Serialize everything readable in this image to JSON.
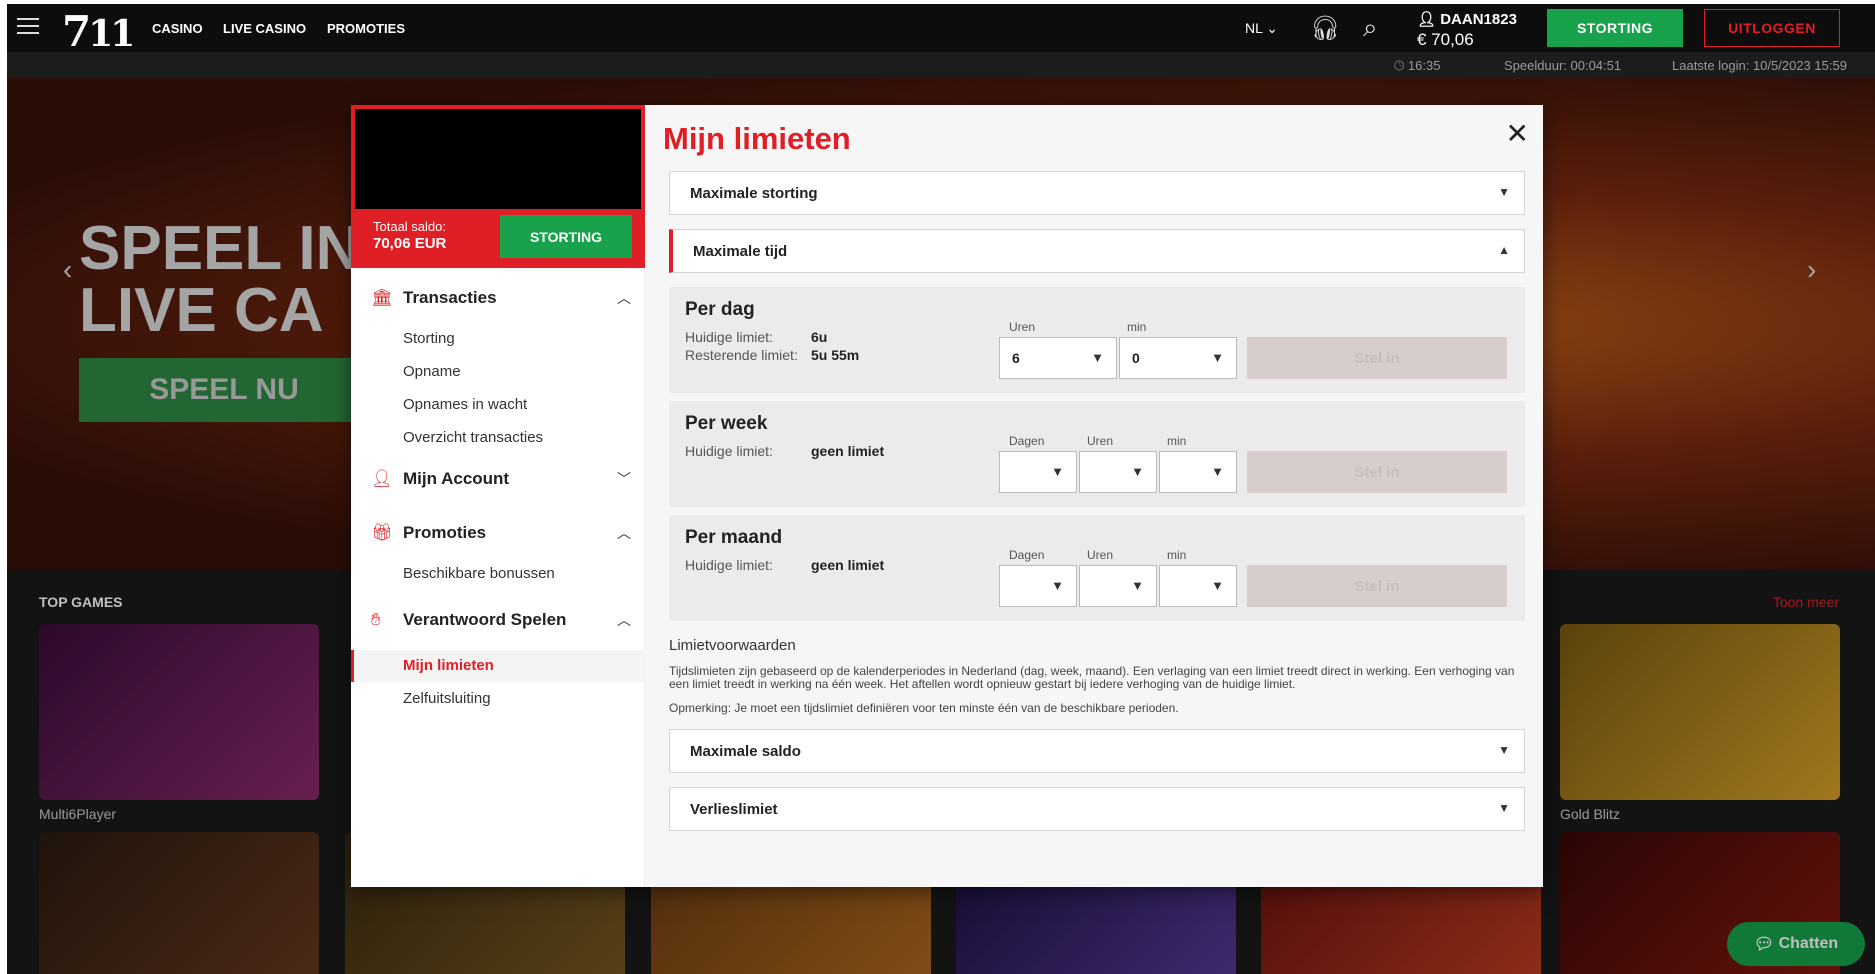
{
  "header": {
    "logo_main": "7",
    "logo_sub": "11",
    "nav": [
      "CASINO",
      "LIVE CASINO",
      "PROMOTIES"
    ],
    "language": "NL",
    "username": "DAAN1823",
    "balance": "€ 70,06",
    "deposit_label": "STORTING",
    "logout_label": "UITLOGGEN"
  },
  "subbar": {
    "time": "16:35",
    "playtime": "Speelduur: 00:04:51",
    "last_login": "Laatste login: 10/5/2023 15:59"
  },
  "hero": {
    "title_line1": "SPEEL IN",
    "title_line2": "LIVE CA",
    "cta": "SPEEL NU"
  },
  "games": {
    "title": "TOP GAMES",
    "more": "Toon meer",
    "tiles": [
      "Multi6Player",
      "Gold Blitz"
    ],
    "chat_label": "Chatten"
  },
  "sidebar": {
    "saldo_label": "Totaal saldo:",
    "saldo_value": "70,06 EUR",
    "deposit_label": "STORTING",
    "sections": [
      {
        "label": "Transacties",
        "icon": "bank-icon",
        "items": [
          "Storting",
          "Opname",
          "Opnames in wacht",
          "Overzicht transacties"
        ]
      },
      {
        "label": "Mijn Account",
        "icon": "user-icon",
        "items": []
      },
      {
        "label": "Promoties",
        "icon": "gift-icon",
        "items": [
          "Beschikbare bonussen"
        ]
      },
      {
        "label": "Verantwoord Spelen",
        "icon": "hand-icon",
        "items": [
          "Mijn limieten",
          "Zelfuitsluiting"
        ]
      }
    ]
  },
  "limits": {
    "title": "Mijn limieten",
    "accordions": {
      "max_deposit": "Maximale storting",
      "max_time": "Maximale tijd",
      "max_balance": "Maximale saldo",
      "loss_limit": "Verlieslimiet"
    },
    "periods": [
      {
        "title": "Per dag",
        "current_label": "Huidige limiet:",
        "current_value": "6u",
        "remaining_label": "Resterende limiet:",
        "remaining_value": "5u 55m",
        "fields": [
          {
            "label": "Uren",
            "value": "6"
          },
          {
            "label": "min",
            "value": "0"
          }
        ],
        "button": "Stel in"
      },
      {
        "title": "Per week",
        "current_label": "Huidige limiet:",
        "current_value": "geen limiet",
        "fields": [
          {
            "label": "Dagen",
            "value": ""
          },
          {
            "label": "Uren",
            "value": ""
          },
          {
            "label": "min",
            "value": ""
          }
        ],
        "button": "Stel in"
      },
      {
        "title": "Per maand",
        "current_label": "Huidige limiet:",
        "current_value": "geen limiet",
        "fields": [
          {
            "label": "Dagen",
            "value": ""
          },
          {
            "label": "Uren",
            "value": ""
          },
          {
            "label": "min",
            "value": ""
          }
        ],
        "button": "Stel in"
      }
    ],
    "conditions_title": "Limietvoorwaarden",
    "conditions_text": "Tijdslimieten zijn gebaseerd op de kalenderperiodes in Nederland (dag, week, maand). Een verlaging van een limiet treedt direct in werking. Een verhoging van een limiet treedt in werking na één week. Het aftellen wordt opnieuw gestart bij iedere verhoging van de huidige limiet.",
    "note": "Opmerking: Je moet een tijdslimiet definiëren voor ten minste één van de beschikbare perioden."
  },
  "colors": {
    "accent": "#e01e25",
    "green": "#17a24b"
  }
}
